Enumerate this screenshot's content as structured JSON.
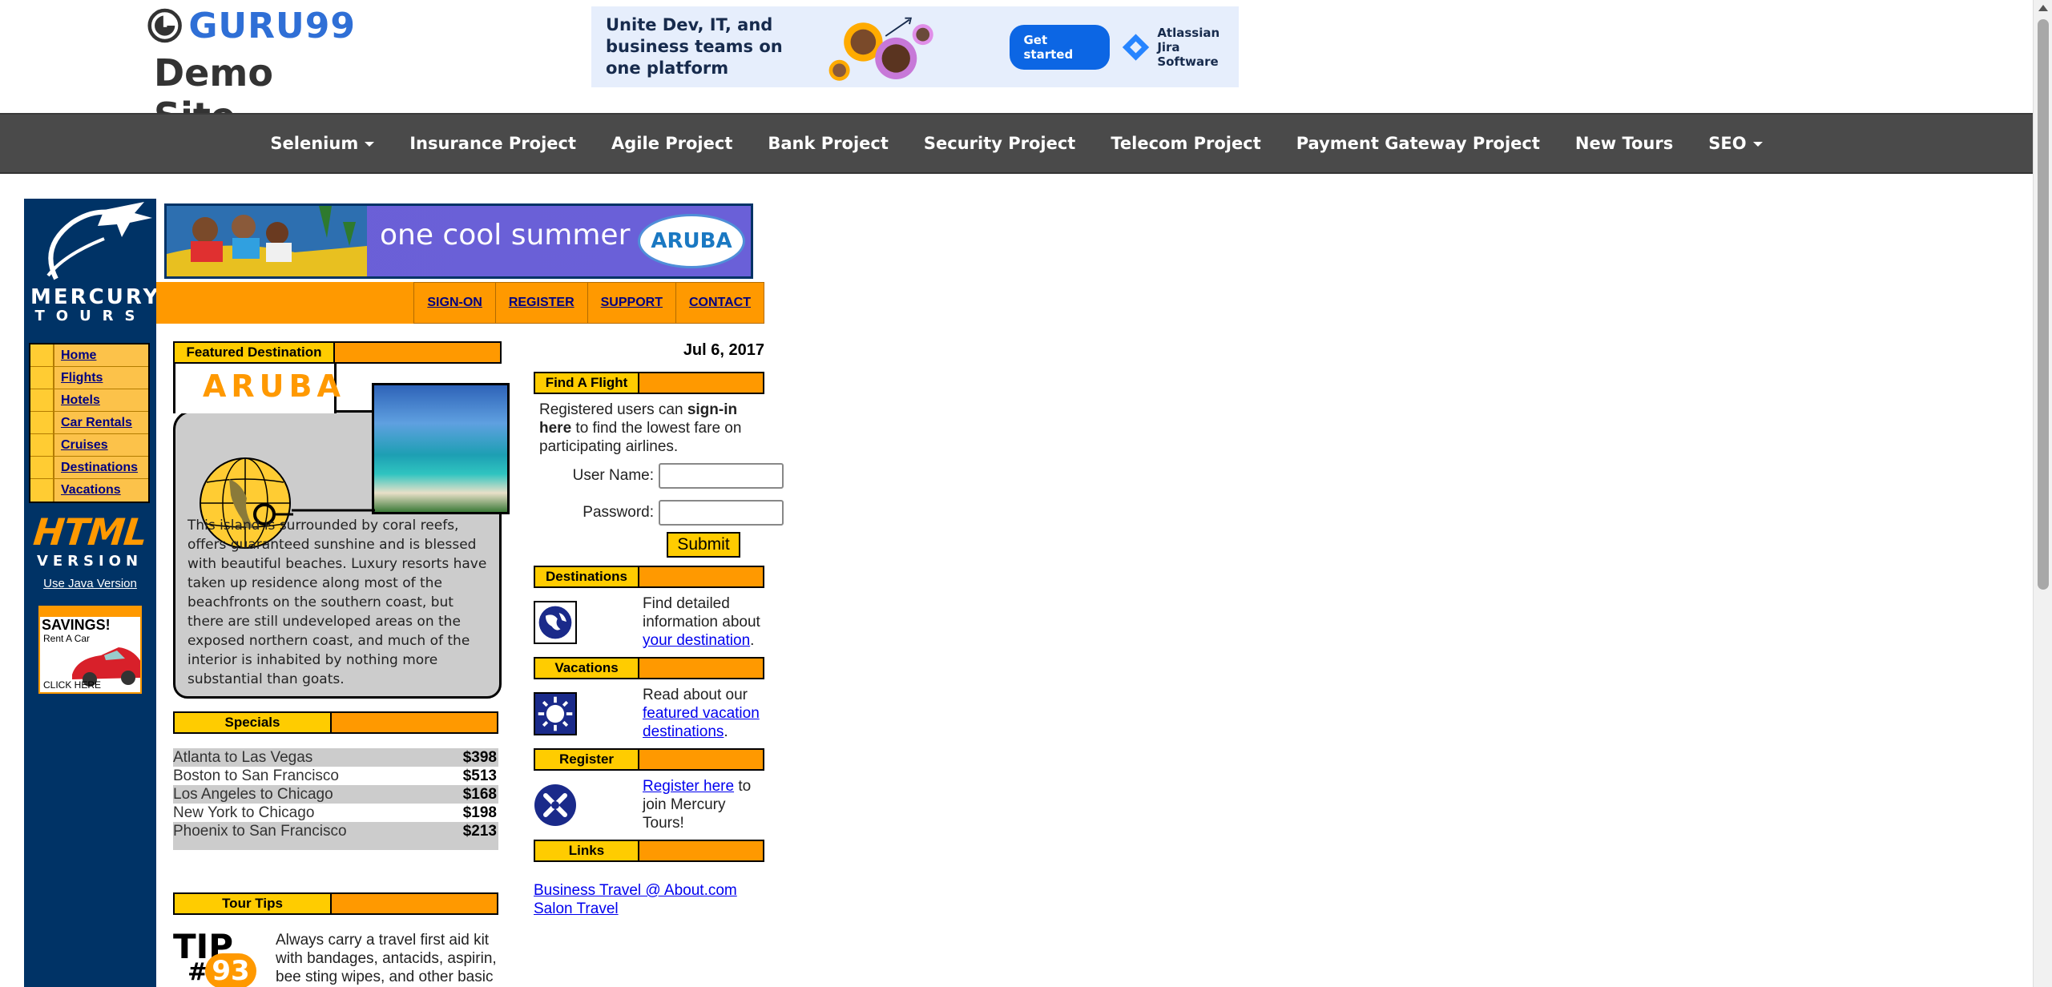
{
  "site": {
    "logo_text": "GURU99",
    "subtitle": "Demo Site"
  },
  "ad": {
    "headline": "Unite Dev, IT, and business teams on one platform",
    "cta": "Get started",
    "brand_line1": "Atlassian",
    "brand_line2": "Jira Software",
    "brand_color": "#0c66e4"
  },
  "navbar": {
    "items": [
      {
        "label": "Selenium",
        "dropdown": true
      },
      {
        "label": "Insurance Project"
      },
      {
        "label": "Agile Project"
      },
      {
        "label": "Bank Project"
      },
      {
        "label": "Security Project"
      },
      {
        "label": "Telecom Project"
      },
      {
        "label": "Payment Gateway Project"
      },
      {
        "label": "New Tours"
      },
      {
        "label": "SEO",
        "dropdown": true
      }
    ]
  },
  "mercury": {
    "logo_word": "MERCURY",
    "logo_sub": "TOURS",
    "banner_text": "one cool summer",
    "banner_badge": "ARUBA",
    "top_links": [
      "SIGN-ON",
      "REGISTER",
      "SUPPORT",
      "CONTACT"
    ],
    "side_menu": [
      "Home",
      "Flights",
      "Hotels",
      "Car Rentals",
      "Cruises",
      "Destinations",
      "Vacations"
    ],
    "html_version_word": "HTML",
    "html_version_sub": "VERSION",
    "java_link": "Use Java Version",
    "savings": {
      "title": "SAVINGS!",
      "sub": "Rent A Car",
      "click": "CLICK HERE"
    },
    "featured": {
      "header": "Featured Destination",
      "name": "ARUBA",
      "description": "This island is surrounded by coral reefs, offers guaranteed sunshine and is blessed with beautiful beaches. Luxury resorts have taken up residence along most of the beachfronts on the southern coast, but there are still undeveloped areas on the exposed northern coast, and much of the interior is inhabited by nothing more substantial than goats."
    },
    "specials": {
      "header": "Specials",
      "rows": [
        {
          "route": "Atlanta to Las Vegas",
          "price": "$398"
        },
        {
          "route": "Boston to San Francisco",
          "price": "$513"
        },
        {
          "route": "Los Angeles to Chicago",
          "price": "$168"
        },
        {
          "route": "New York to Chicago",
          "price": "$198"
        },
        {
          "route": "Phoenix to San Francisco",
          "price": "$213"
        }
      ]
    },
    "tour_tips": {
      "header": "Tour Tips",
      "tip_word": "TIP",
      "tip_hash": "#",
      "tip_number": "93",
      "text": "Always carry a travel first aid kit with bandages, antacids, aspirin, bee sting wipes, and other basic"
    },
    "date": "Jul 6, 2017",
    "find_flight": {
      "header": "Find A Flight",
      "text_before": "Registered users can ",
      "text_bold": "sign-in here",
      "text_after": " to find the lowest fare on participating airlines.",
      "username_label": "User Name:",
      "username_value": "",
      "password_label": "Password:",
      "password_value": "",
      "submit": "Submit"
    },
    "destinations": {
      "header": "Destinations",
      "text": "Find detailed information about ",
      "link": "your destination",
      "after": "."
    },
    "vacations": {
      "header": "Vacations",
      "text": "Read about our ",
      "link": "featured vacation destinations",
      "after": "."
    },
    "register": {
      "header": "Register",
      "link": "Register here",
      "after": " to join Mercury Tours!"
    },
    "links": {
      "header": "Links",
      "items": [
        "Business Travel @ About.com",
        "Salon Travel"
      ]
    }
  },
  "colors": {
    "navy": "#003366",
    "orange": "#ff9900",
    "yellow": "#ffcc00",
    "link": "#0000ee"
  }
}
